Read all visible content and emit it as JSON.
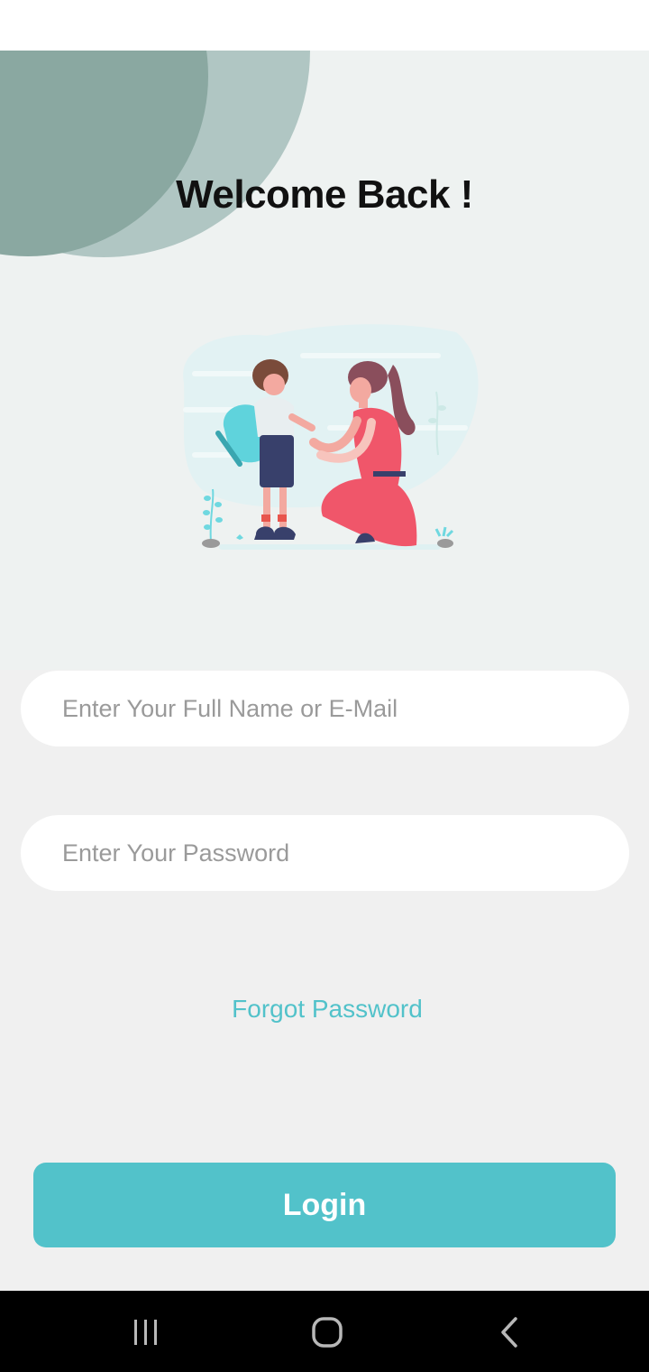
{
  "header": {
    "title": "Welcome Back !"
  },
  "form": {
    "name_placeholder": "Enter Your Full Name or E-Mail",
    "password_placeholder": "Enter Your Password",
    "forgot_label": "Forgot Password",
    "login_label": "Login"
  },
  "illustration": {
    "icon": "parent-child-illustration"
  },
  "nav": {
    "icons": [
      "recents-icon",
      "home-icon",
      "back-icon"
    ]
  },
  "colors": {
    "accent": "#52c2ca",
    "hero_bg": "#eef2f1",
    "page_bg": "#f0f0f0",
    "circle_light": "#b0c6c3",
    "circle_dark": "#8aa8a1"
  }
}
